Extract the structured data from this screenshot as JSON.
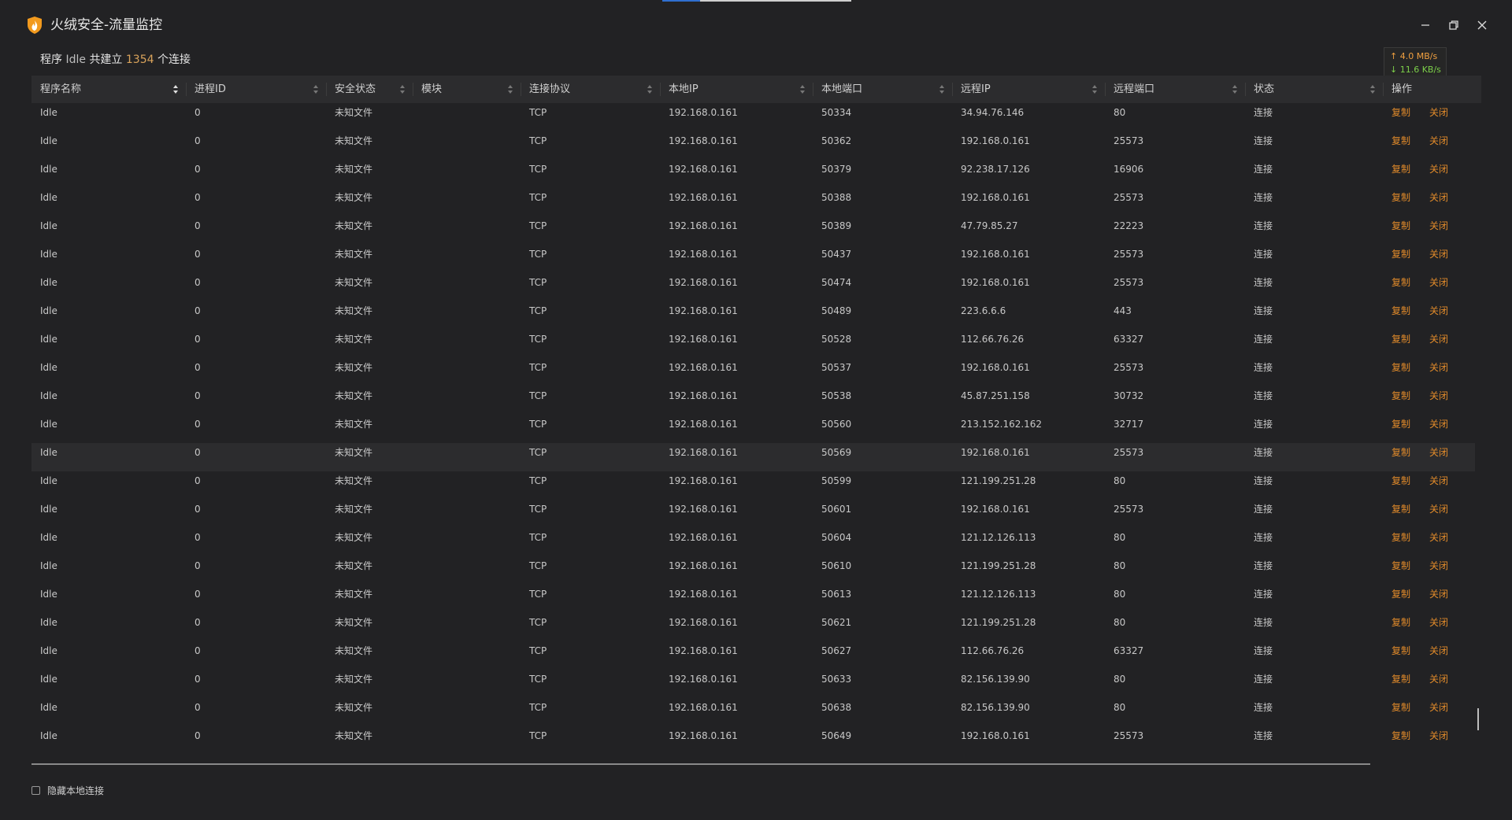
{
  "window": {
    "title": "火绒安全-流量监控"
  },
  "summary": {
    "prefix": "程序",
    "program": "Idle",
    "middle": "共建立",
    "count": "1354",
    "suffix": "个连接"
  },
  "speed": {
    "up": "↑ 4.0 MB/s",
    "down": "↓ 11.6 KB/s",
    "up_color": "#f0a040",
    "down_color": "#7ccf4a"
  },
  "columns": [
    "程序名称",
    "进程ID",
    "安全状态",
    "模块",
    "连接协议",
    "本地IP",
    "本地端口",
    "远程IP",
    "远程端口",
    "状态",
    "操作"
  ],
  "actions": {
    "copy": "复制",
    "close": "关闭",
    "color": "#e08a2a"
  },
  "rows": [
    [
      "Idle",
      "0",
      "未知文件",
      "",
      "TCP",
      "192.168.0.161",
      "50334",
      "34.94.76.146",
      "80",
      "连接"
    ],
    [
      "Idle",
      "0",
      "未知文件",
      "",
      "TCP",
      "192.168.0.161",
      "50362",
      "192.168.0.161",
      "25573",
      "连接"
    ],
    [
      "Idle",
      "0",
      "未知文件",
      "",
      "TCP",
      "192.168.0.161",
      "50379",
      "92.238.17.126",
      "16906",
      "连接"
    ],
    [
      "Idle",
      "0",
      "未知文件",
      "",
      "TCP",
      "192.168.0.161",
      "50388",
      "192.168.0.161",
      "25573",
      "连接"
    ],
    [
      "Idle",
      "0",
      "未知文件",
      "",
      "TCP",
      "192.168.0.161",
      "50389",
      "47.79.85.27",
      "22223",
      "连接"
    ],
    [
      "Idle",
      "0",
      "未知文件",
      "",
      "TCP",
      "192.168.0.161",
      "50437",
      "192.168.0.161",
      "25573",
      "连接"
    ],
    [
      "Idle",
      "0",
      "未知文件",
      "",
      "TCP",
      "192.168.0.161",
      "50474",
      "192.168.0.161",
      "25573",
      "连接"
    ],
    [
      "Idle",
      "0",
      "未知文件",
      "",
      "TCP",
      "192.168.0.161",
      "50489",
      "223.6.6.6",
      "443",
      "连接"
    ],
    [
      "Idle",
      "0",
      "未知文件",
      "",
      "TCP",
      "192.168.0.161",
      "50528",
      "112.66.76.26",
      "63327",
      "连接"
    ],
    [
      "Idle",
      "0",
      "未知文件",
      "",
      "TCP",
      "192.168.0.161",
      "50537",
      "192.168.0.161",
      "25573",
      "连接"
    ],
    [
      "Idle",
      "0",
      "未知文件",
      "",
      "TCP",
      "192.168.0.161",
      "50538",
      "45.87.251.158",
      "30732",
      "连接"
    ],
    [
      "Idle",
      "0",
      "未知文件",
      "",
      "TCP",
      "192.168.0.161",
      "50560",
      "213.152.162.162",
      "32717",
      "连接"
    ],
    [
      "Idle",
      "0",
      "未知文件",
      "",
      "TCP",
      "192.168.0.161",
      "50569",
      "192.168.0.161",
      "25573",
      "连接"
    ],
    [
      "Idle",
      "0",
      "未知文件",
      "",
      "TCP",
      "192.168.0.161",
      "50599",
      "121.199.251.28",
      "80",
      "连接"
    ],
    [
      "Idle",
      "0",
      "未知文件",
      "",
      "TCP",
      "192.168.0.161",
      "50601",
      "192.168.0.161",
      "25573",
      "连接"
    ],
    [
      "Idle",
      "0",
      "未知文件",
      "",
      "TCP",
      "192.168.0.161",
      "50604",
      "121.12.126.113",
      "80",
      "连接"
    ],
    [
      "Idle",
      "0",
      "未知文件",
      "",
      "TCP",
      "192.168.0.161",
      "50610",
      "121.199.251.28",
      "80",
      "连接"
    ],
    [
      "Idle",
      "0",
      "未知文件",
      "",
      "TCP",
      "192.168.0.161",
      "50613",
      "121.12.126.113",
      "80",
      "连接"
    ],
    [
      "Idle",
      "0",
      "未知文件",
      "",
      "TCP",
      "192.168.0.161",
      "50621",
      "121.199.251.28",
      "80",
      "连接"
    ],
    [
      "Idle",
      "0",
      "未知文件",
      "",
      "TCP",
      "192.168.0.161",
      "50627",
      "112.66.76.26",
      "63327",
      "连接"
    ],
    [
      "Idle",
      "0",
      "未知文件",
      "",
      "TCP",
      "192.168.0.161",
      "50633",
      "82.156.139.90",
      "80",
      "连接"
    ],
    [
      "Idle",
      "0",
      "未知文件",
      "",
      "TCP",
      "192.168.0.161",
      "50638",
      "82.156.139.90",
      "80",
      "连接"
    ],
    [
      "Idle",
      "0",
      "未知文件",
      "",
      "TCP",
      "192.168.0.161",
      "50649",
      "192.168.0.161",
      "25573",
      "连接"
    ]
  ],
  "hovered_row": 12,
  "footer": {
    "hide_local_label": "隐藏本地连接",
    "hide_local_checked": false
  },
  "icons": {
    "app": "huorong-shield-icon",
    "minimize": "minimize-icon",
    "restore": "restore-icon",
    "close": "close-icon",
    "sort": "sort-arrows-icon"
  }
}
